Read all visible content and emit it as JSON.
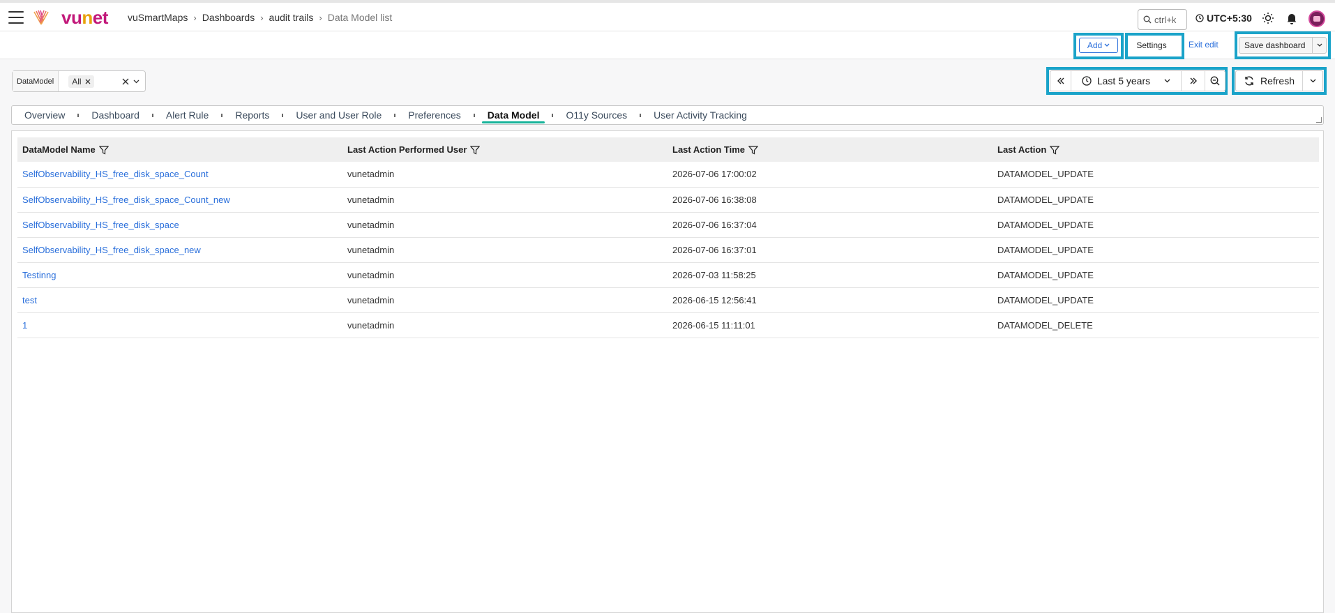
{
  "header": {
    "brand": {
      "part1": "vu",
      "part2": "n",
      "part3": "et"
    },
    "breadcrumb": [
      "vuSmartMaps",
      "Dashboards",
      "audit trails",
      "Data Model list"
    ],
    "search_placeholder": "ctrl+k",
    "timezone": "UTC+5:30"
  },
  "editbar": {
    "add_label": "Add",
    "settings_label": "Settings",
    "exit_label": "Exit edit",
    "save_label": "Save dashboard"
  },
  "filter": {
    "key": "DataModel",
    "value": "All"
  },
  "timepicker": {
    "range_label": "Last 5 years",
    "refresh_label": "Refresh"
  },
  "tabs": [
    {
      "label": "Overview",
      "active": false
    },
    {
      "label": "Dashboard",
      "active": false
    },
    {
      "label": "Alert Rule",
      "active": false
    },
    {
      "label": "Reports",
      "active": false
    },
    {
      "label": "User and User Role",
      "active": false
    },
    {
      "label": "Preferences",
      "active": false
    },
    {
      "label": "Data Model",
      "active": true
    },
    {
      "label": "O11y Sources",
      "active": false
    },
    {
      "label": "User Activity Tracking",
      "active": false
    }
  ],
  "table": {
    "columns": [
      "DataModel Name",
      "Last Action Performed User",
      "Last Action Time",
      "Last Action"
    ],
    "rows": [
      [
        "SelfObservability_HS_free_disk_space_Count",
        "vunetadmin",
        "2026-07-06 17:00:02",
        "DATAMODEL_UPDATE"
      ],
      [
        "SelfObservability_HS_free_disk_space_Count_new",
        "vunetadmin",
        "2026-07-06 16:38:08",
        "DATAMODEL_UPDATE"
      ],
      [
        "SelfObservability_HS_free_disk_space",
        "vunetadmin",
        "2026-07-06 16:37:04",
        "DATAMODEL_UPDATE"
      ],
      [
        "SelfObservability_HS_free_disk_space_new",
        "vunetadmin",
        "2026-07-06 16:37:01",
        "DATAMODEL_UPDATE"
      ],
      [
        "Testinng",
        "vunetadmin",
        "2026-07-03 11:58:25",
        "DATAMODEL_UPDATE"
      ],
      [
        "test",
        "vunetadmin",
        "2026-06-15 12:56:41",
        "DATAMODEL_UPDATE"
      ],
      [
        "1",
        "vunetadmin",
        "2026-06-15 11:11:01",
        "DATAMODEL_DELETE"
      ]
    ]
  },
  "colors": {
    "highlight": "#1aa3c9",
    "link": "#2a6fdb",
    "active_tab": "#16b39a",
    "brand_pink": "#c2187a",
    "brand_orange": "#e8a10c"
  }
}
